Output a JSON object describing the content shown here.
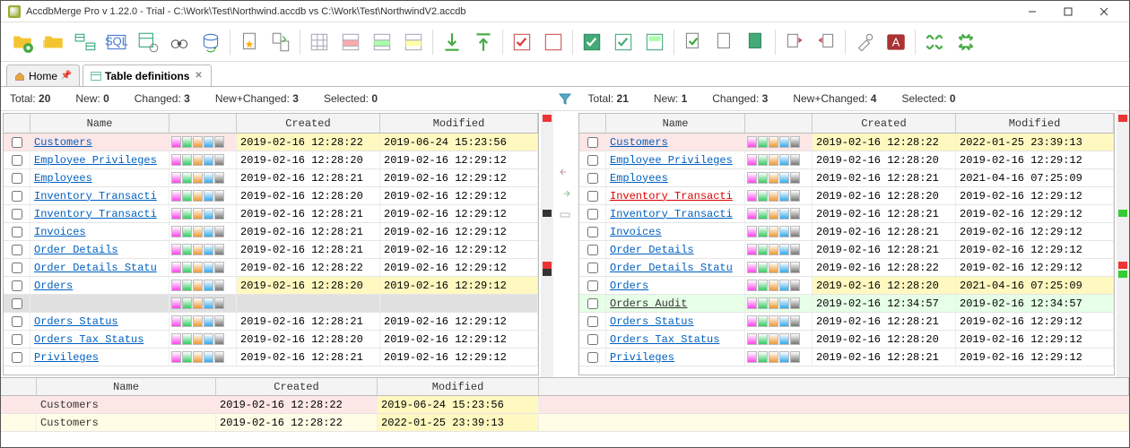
{
  "window": {
    "title": "AccdbMerge Pro v 1.22.0 - Trial - C:\\Work\\Test\\Northwind.accdb vs C:\\Work\\Test\\NorthwindV2.accdb"
  },
  "tabs": {
    "home": "Home",
    "active": "Table definitions"
  },
  "stats": {
    "left": {
      "total": "20",
      "new": "0",
      "changed": "3",
      "newchanged": "3",
      "selected": "0"
    },
    "right": {
      "total": "21",
      "new": "1",
      "changed": "3",
      "newchanged": "4",
      "selected": "0"
    }
  },
  "columns": {
    "name": "Name",
    "created": "Created",
    "modified": "Modified"
  },
  "left_rows": [
    {
      "name": "Customers",
      "created": "2019-02-16 12:28:22",
      "modified": "2019-06-24 15:23:56",
      "kind": "changed",
      "selected": true,
      "hlCreated": true,
      "hlModified": true
    },
    {
      "name": "Employee Privileges",
      "created": "2019-02-16 12:28:20",
      "modified": "2019-02-16 12:29:12"
    },
    {
      "name": "Employees",
      "created": "2019-02-16 12:28:21",
      "modified": "2019-02-16 12:29:12"
    },
    {
      "name": "Inventory Transacti",
      "created": "2019-02-16 12:28:20",
      "modified": "2019-02-16 12:29:12"
    },
    {
      "name": "Inventory Transacti",
      "created": "2019-02-16 12:28:21",
      "modified": "2019-02-16 12:29:12"
    },
    {
      "name": "Invoices",
      "created": "2019-02-16 12:28:21",
      "modified": "2019-02-16 12:29:12"
    },
    {
      "name": "Order Details",
      "created": "2019-02-16 12:28:21",
      "modified": "2019-02-16 12:29:12"
    },
    {
      "name": "Order Details Statu",
      "created": "2019-02-16 12:28:22",
      "modified": "2019-02-16 12:29:12"
    },
    {
      "name": "Orders",
      "created": "2019-02-16 12:28:20",
      "modified": "2019-02-16 12:29:12",
      "kind": "changed",
      "hlCreated": true,
      "hlModified": true
    },
    {
      "name": "",
      "created": "",
      "modified": "",
      "kind": "placeholder"
    },
    {
      "name": "Orders Status",
      "created": "2019-02-16 12:28:21",
      "modified": "2019-02-16 12:29:12"
    },
    {
      "name": "Orders Tax Status",
      "created": "2019-02-16 12:28:20",
      "modified": "2019-02-16 12:29:12"
    },
    {
      "name": "Privileges",
      "created": "2019-02-16 12:28:21",
      "modified": "2019-02-16 12:29:12"
    }
  ],
  "right_rows": [
    {
      "name": "Customers",
      "created": "2019-02-16 12:28:22",
      "modified": "2022-01-25 23:39:13",
      "kind": "changed",
      "selected": true,
      "hlCreated": true,
      "hlModified": true
    },
    {
      "name": "Employee Privileges",
      "created": "2019-02-16 12:28:20",
      "modified": "2019-02-16 12:29:12"
    },
    {
      "name": "Employees",
      "created": "2019-02-16 12:28:21",
      "modified": "2021-04-16 07:25:09"
    },
    {
      "name": "Inventory Transacti",
      "created": "2019-02-16 12:28:20",
      "modified": "2019-02-16 12:29:12",
      "newitem": true
    },
    {
      "name": "Inventory Transacti",
      "created": "2019-02-16 12:28:21",
      "modified": "2019-02-16 12:29:12"
    },
    {
      "name": "Invoices",
      "created": "2019-02-16 12:28:21",
      "modified": "2019-02-16 12:29:12"
    },
    {
      "name": "Order Details",
      "created": "2019-02-16 12:28:21",
      "modified": "2019-02-16 12:29:12"
    },
    {
      "name": "Order Details Statu",
      "created": "2019-02-16 12:28:22",
      "modified": "2019-02-16 12:29:12"
    },
    {
      "name": "Orders",
      "created": "2019-02-16 12:28:20",
      "modified": "2021-04-16 07:25:09",
      "kind": "changed",
      "hlCreated": true,
      "hlModified": true
    },
    {
      "name": "Orders Audit",
      "created": "2019-02-16 12:34:57",
      "modified": "2019-02-16 12:34:57",
      "kind": "new",
      "neutral": true
    },
    {
      "name": "Orders Status",
      "created": "2019-02-16 12:28:21",
      "modified": "2019-02-16 12:29:12"
    },
    {
      "name": "Orders Tax Status",
      "created": "2019-02-16 12:28:20",
      "modified": "2019-02-16 12:29:12"
    },
    {
      "name": "Privileges",
      "created": "2019-02-16 12:28:21",
      "modified": "2019-02-16 12:29:12"
    }
  ],
  "detail_rows": [
    {
      "name": "Customers",
      "created": "2019-02-16 12:28:22",
      "modified": "2019-06-24 15:23:56",
      "hl": "left"
    },
    {
      "name": "Customers",
      "created": "2019-02-16 12:28:22",
      "modified": "2022-01-25 23:39:13",
      "hl": "right"
    }
  ],
  "stat_labels": {
    "total": "Total:",
    "new": "New:",
    "changed": "Changed:",
    "newchanged": "New+Changed:",
    "selected": "Selected:"
  }
}
